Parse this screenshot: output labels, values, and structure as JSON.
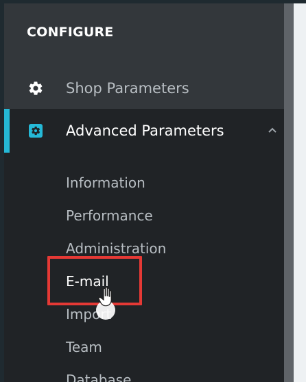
{
  "sidebar": {
    "section_title": "CONFIGURE",
    "items": [
      {
        "label": "Shop Parameters",
        "icon": "gear-icon"
      },
      {
        "label": "Advanced Parameters",
        "icon": "settings-box-icon",
        "expanded_indicator": "chevron-up-icon",
        "children": [
          "Information",
          "Performance",
          "Administration",
          "E-mail",
          "Import",
          "Team",
          "Database"
        ]
      }
    ]
  },
  "colors": {
    "sidebar_background": "#33373b",
    "submenu_background": "#202326",
    "accent": "#25b9d7",
    "highlight_border": "#e53935",
    "text_primary": "#ffffff",
    "text_secondary": "#b8bec3"
  }
}
